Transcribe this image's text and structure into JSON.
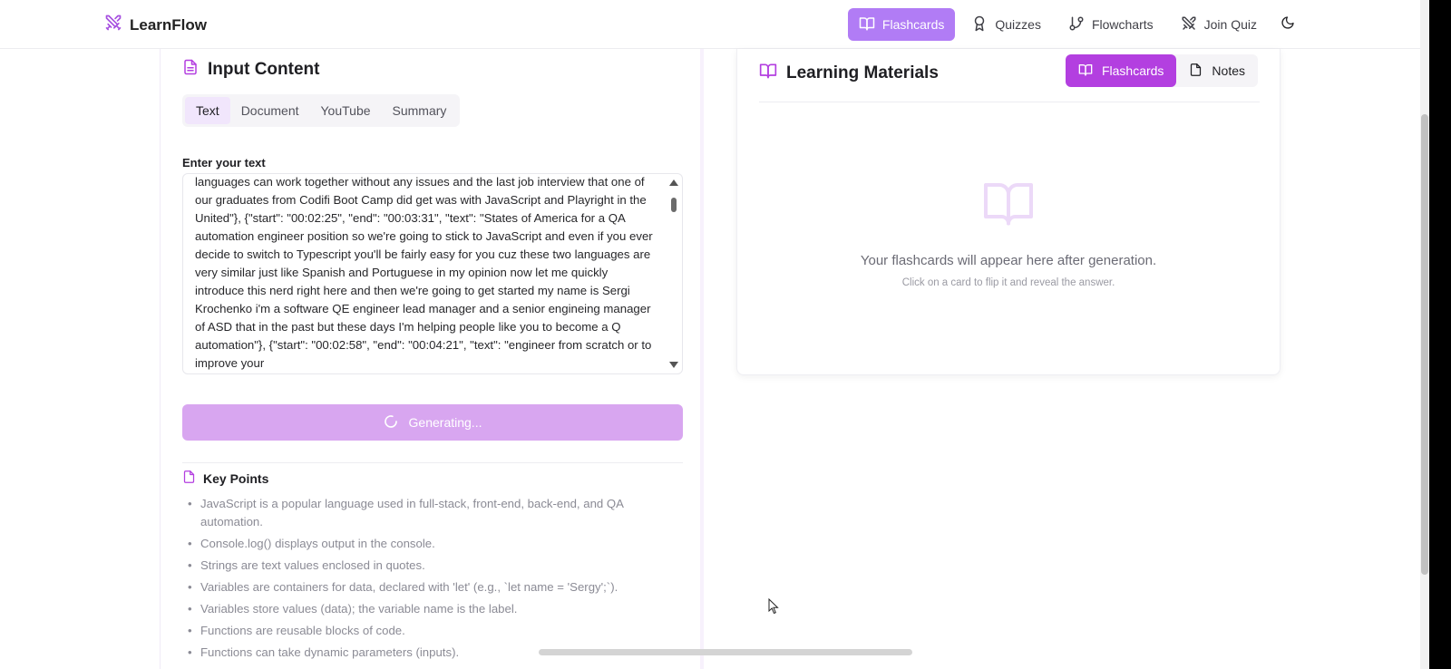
{
  "app": {
    "name": "LearnFlow"
  },
  "nav": {
    "items": [
      {
        "label": "Flashcards",
        "icon": "book-open-icon",
        "active": true
      },
      {
        "label": "Quizzes",
        "icon": "award-icon",
        "active": false
      },
      {
        "label": "Flowcharts",
        "icon": "git-branch-icon",
        "active": false
      },
      {
        "label": "Join Quiz",
        "icon": "swords-icon",
        "active": false
      }
    ],
    "theme_icon": "moon-icon"
  },
  "input_panel": {
    "title": "Input Content",
    "tabs": [
      "Text",
      "Document",
      "YouTube",
      "Summary"
    ],
    "active_tab": "Text",
    "field_label": "Enter your text",
    "text_value": "languages can work together without any issues and the last job interview that one of our graduates from Codifi Boot Camp did get was with JavaScript and Playright in the United\"}, {\"start\": \"00:02:25\", \"end\": \"00:03:31\", \"text\": \"States of America for a QA automation engineer position so we're going to stick to JavaScript and even if you ever decide to switch to Typescript you'll be fairly easy for you cuz these two languages are very similar just like Spanish and Portuguese in my opinion now let me quickly introduce this nerd right here and then we're going to get started my name is Sergi Krochenko i'm a software QE engineer lead manager and a senior engineing manager of ASD that in the past but these days I'm helping people like you to become a Q automation\"}, {\"start\": \"00:02:58\", \"end\": \"00:04:21\", \"text\": \"engineer from scratch or to improve your",
    "generate_label": "Generating...",
    "key_points_title": "Key Points",
    "key_points": [
      "JavaScript is a popular language used in full-stack, front-end, back-end, and QA automation.",
      "Console.log() displays output in the console.",
      "Strings are text values enclosed in quotes.",
      "Variables are containers for data, declared with 'let' (e.g., `let name = 'Sergy';`).",
      "Variables store values (data); the variable name is the label.",
      "Functions are reusable blocks of code.",
      "Functions can take dynamic parameters (inputs)."
    ]
  },
  "materials_panel": {
    "title": "Learning Materials",
    "toggle": [
      {
        "label": "Flashcards",
        "active": true
      },
      {
        "label": "Notes",
        "active": false
      }
    ],
    "empty_title": "Your flashcards will appear here after generation.",
    "empty_subtitle": "Click on a card to flip it and reveal the answer."
  },
  "colors": {
    "accent": "#b17cf5",
    "accent_strong": "#b33fe0",
    "generate_disabled": "#d8a6f0"
  }
}
